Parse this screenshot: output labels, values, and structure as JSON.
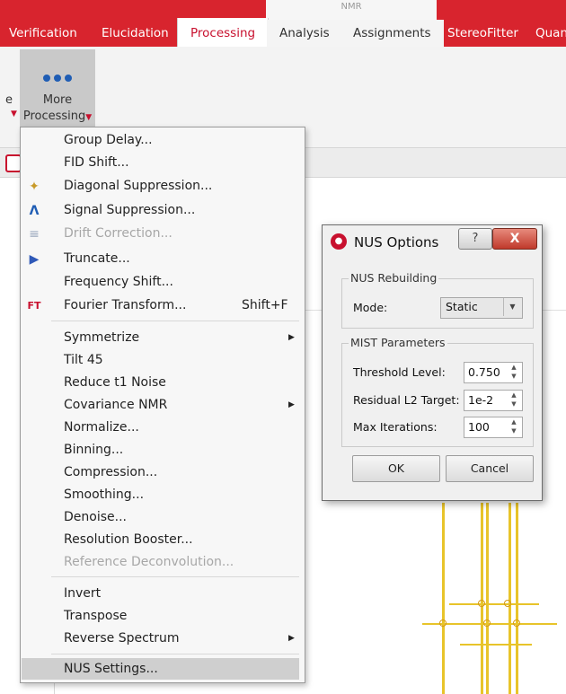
{
  "tabs": {
    "group_label": "NMR",
    "items": [
      "Verification",
      "Elucidation",
      "Processing",
      "Analysis",
      "Assignments",
      "StereoFitter",
      "Quant"
    ]
  },
  "ribbon": {
    "more_label_1": "More",
    "more_label_2": "Processing",
    "truncated_label": "e"
  },
  "menu": {
    "items": [
      {
        "label": "Group Delay...",
        "icon": ""
      },
      {
        "label": "FID Shift...",
        "icon": ""
      },
      {
        "label": "Diagonal Suppression...",
        "icon": "diagonal-suppression-icon"
      },
      {
        "label": "Signal Suppression...",
        "icon": "signal-suppression-icon"
      },
      {
        "label": "Drift Correction...",
        "icon": "drift-correction-icon",
        "disabled": true
      },
      {
        "label": "Truncate...",
        "icon": "truncate-icon"
      },
      {
        "label": "Frequency Shift...",
        "icon": ""
      },
      {
        "label": "Fourier Transform...",
        "icon": "fourier-transform-icon",
        "shortcut": "Shift+F"
      },
      {
        "label": "Symmetrize",
        "submenu": true
      },
      {
        "label": "Tilt 45"
      },
      {
        "label": "Reduce t1 Noise"
      },
      {
        "label": "Covariance NMR",
        "submenu": true
      },
      {
        "label": "Normalize..."
      },
      {
        "label": "Binning..."
      },
      {
        "label": "Compression..."
      },
      {
        "label": "Smoothing..."
      },
      {
        "label": "Denoise..."
      },
      {
        "label": "Resolution Booster..."
      },
      {
        "label": "Reference Deconvolution...",
        "disabled": true
      },
      {
        "label": "Invert"
      },
      {
        "label": "Transpose"
      },
      {
        "label": "Reverse Spectrum",
        "submenu": true
      },
      {
        "label": "NUS Settings...",
        "highlighted": true
      }
    ],
    "ft_icon_text": "FT"
  },
  "dialog": {
    "title": "NUS Options",
    "help_label": "?",
    "close_label": "X",
    "nus_group": "NUS Rebuilding",
    "mode_label": "Mode:",
    "mode_value": "Static",
    "mist_group": "MIST Parameters",
    "threshold_label": "Threshold Level:",
    "threshold_value": "0.750",
    "residual_label": "Residual L2 Target:",
    "residual_value": "1e-2",
    "iterations_label": "Max Iterations:",
    "iterations_value": "100",
    "ok_label": "OK",
    "cancel_label": "Cancel"
  },
  "colors": {
    "brand_red": "#d8242e",
    "spectrum_yellow": "#e8c42a"
  }
}
